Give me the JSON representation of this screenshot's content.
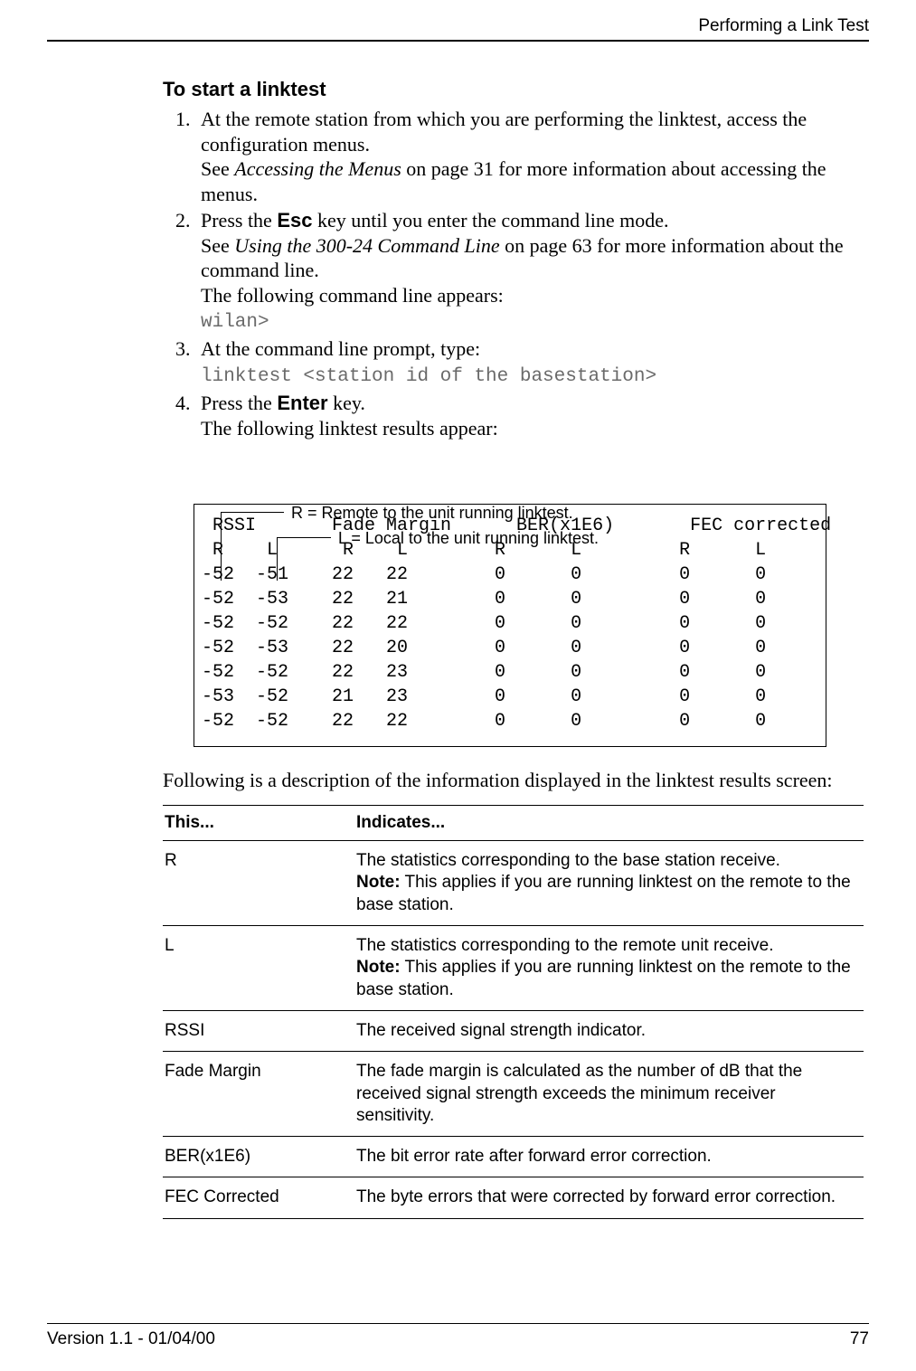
{
  "header": {
    "title": "Performing a Link Test"
  },
  "section_title": "To start a linktest",
  "steps": {
    "s1": {
      "line1a": "At the remote station from which you are performing the linktest, access the configuration menus.",
      "line2a": "See ",
      "line2b": "Accessing the Menus",
      "line2c": " on page 31 for more information about accessing the menus."
    },
    "s2": {
      "line1a": "Press the ",
      "esc": "Esc",
      "line1b": " key until you enter the command line mode.",
      "line2a": "See ",
      "line2b": "Using the 300-24 Command Line",
      "line2c": " on page 63 for more information about the command line.",
      "line3": "The following command line appears:",
      "cmd": "wilan>"
    },
    "s3": {
      "line1": "At the command line prompt, type:",
      "cmd": "linktest <station id of the basestation>"
    },
    "s4": {
      "line1a": "Press the ",
      "enter": "Enter",
      "line1b": " key.",
      "line2": "The following linktest results appear:"
    }
  },
  "callouts": {
    "r": "R = Remote to the unit running linktest.",
    "l": "L = Local to the unit running linktest."
  },
  "results_box": " RSSI       Fade Margin      BER(x1E6)       FEC corrected\n R    L      R    L        R      L         R      L\n-52  -51    22   22        0      0         0      0\n-52  -53    22   21        0      0         0      0\n-52  -52    22   22        0      0         0      0\n-52  -53    22   20        0      0         0      0\n-52  -52    22   23        0      0         0      0\n-53  -52    21   23        0      0         0      0\n-52  -52    22   22        0      0         0      0",
  "after_box": "Following is a description of the information displayed in the linktest results screen:",
  "table": {
    "h1": "This...",
    "h2": "Indicates...",
    "rows": [
      {
        "this": "R",
        "ind_a": "The statistics corresponding to the base station receive.",
        "note_lbl": "Note:",
        "note": " This applies if you are running linktest on the remote to the base station."
      },
      {
        "this": "L",
        "ind_a": "The statistics corresponding to the remote unit receive.",
        "note_lbl": "Note:",
        "note": " This applies if you are running linktest on the remote to the base station."
      },
      {
        "this": "RSSI",
        "ind_a": "The received signal strength indicator."
      },
      {
        "this": "Fade Margin",
        "ind_a": "The fade margin is calculated as the number of dB that the received signal strength exceeds the minimum receiver sensitivity."
      },
      {
        "this": "BER(x1E6)",
        "ind_a": "The bit error rate after forward error correction."
      },
      {
        "this": "FEC Corrected",
        "ind_a": "The byte errors that were corrected by forward error correction."
      }
    ]
  },
  "footer": {
    "version": "Version 1.1 - 01/04/00",
    "page": "77"
  }
}
